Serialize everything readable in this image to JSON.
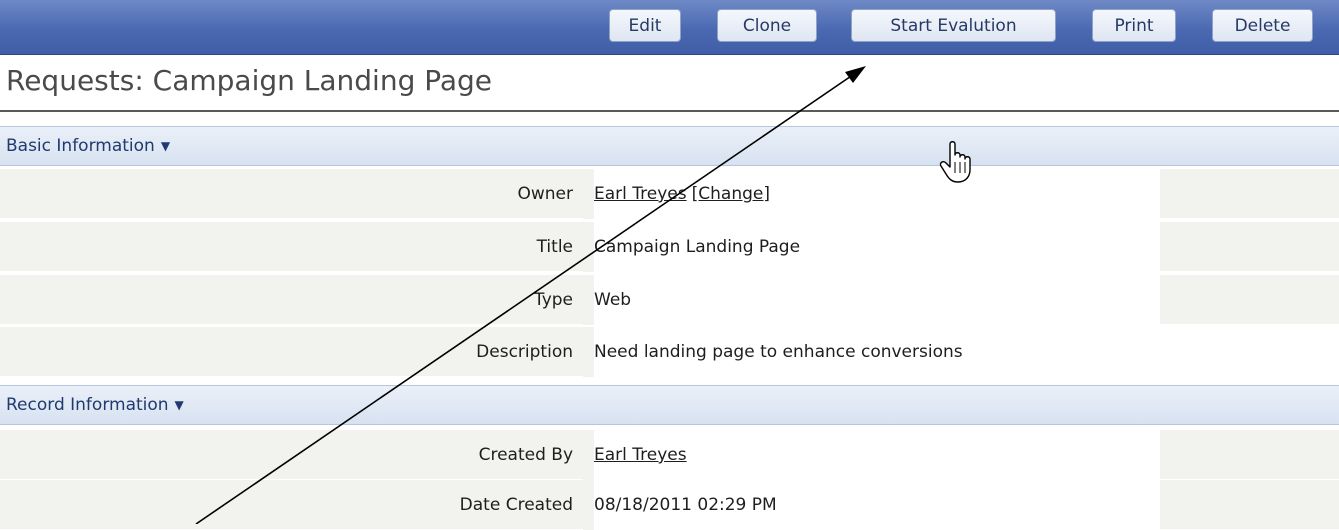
{
  "toolbar": {
    "buttons": [
      {
        "label": "Edit"
      },
      {
        "label": "Clone"
      },
      {
        "label": "Start Evalution"
      },
      {
        "label": "Print"
      },
      {
        "label": "Delete"
      }
    ]
  },
  "page": {
    "title": "Requests: Campaign Landing Page"
  },
  "sections": {
    "basic": {
      "header": "Basic Information",
      "owner": {
        "label": "Owner",
        "name": "Earl Treyes",
        "change": "[Change]"
      },
      "title": {
        "label": "Title",
        "value": "Campaign Landing Page"
      },
      "type": {
        "label": "Type",
        "value": "Web"
      },
      "description": {
        "label": "Description",
        "value": "Need landing page to enhance conversions"
      }
    },
    "record": {
      "header": "Record Information",
      "created_by": {
        "label": "Created By",
        "value": "Earl Treyes"
      },
      "date_created": {
        "label": "Date Created",
        "value": "08/18/2011 02:29 PM"
      }
    }
  },
  "icons": {
    "caret": "caret-down-icon",
    "cursor": "hand-pointer-icon",
    "annotation": "arrow-annotation"
  },
  "colors": {
    "toolbar": "#4a69b1",
    "section_header": "#dfe7f3",
    "label_cell": "#f2f3ee"
  }
}
